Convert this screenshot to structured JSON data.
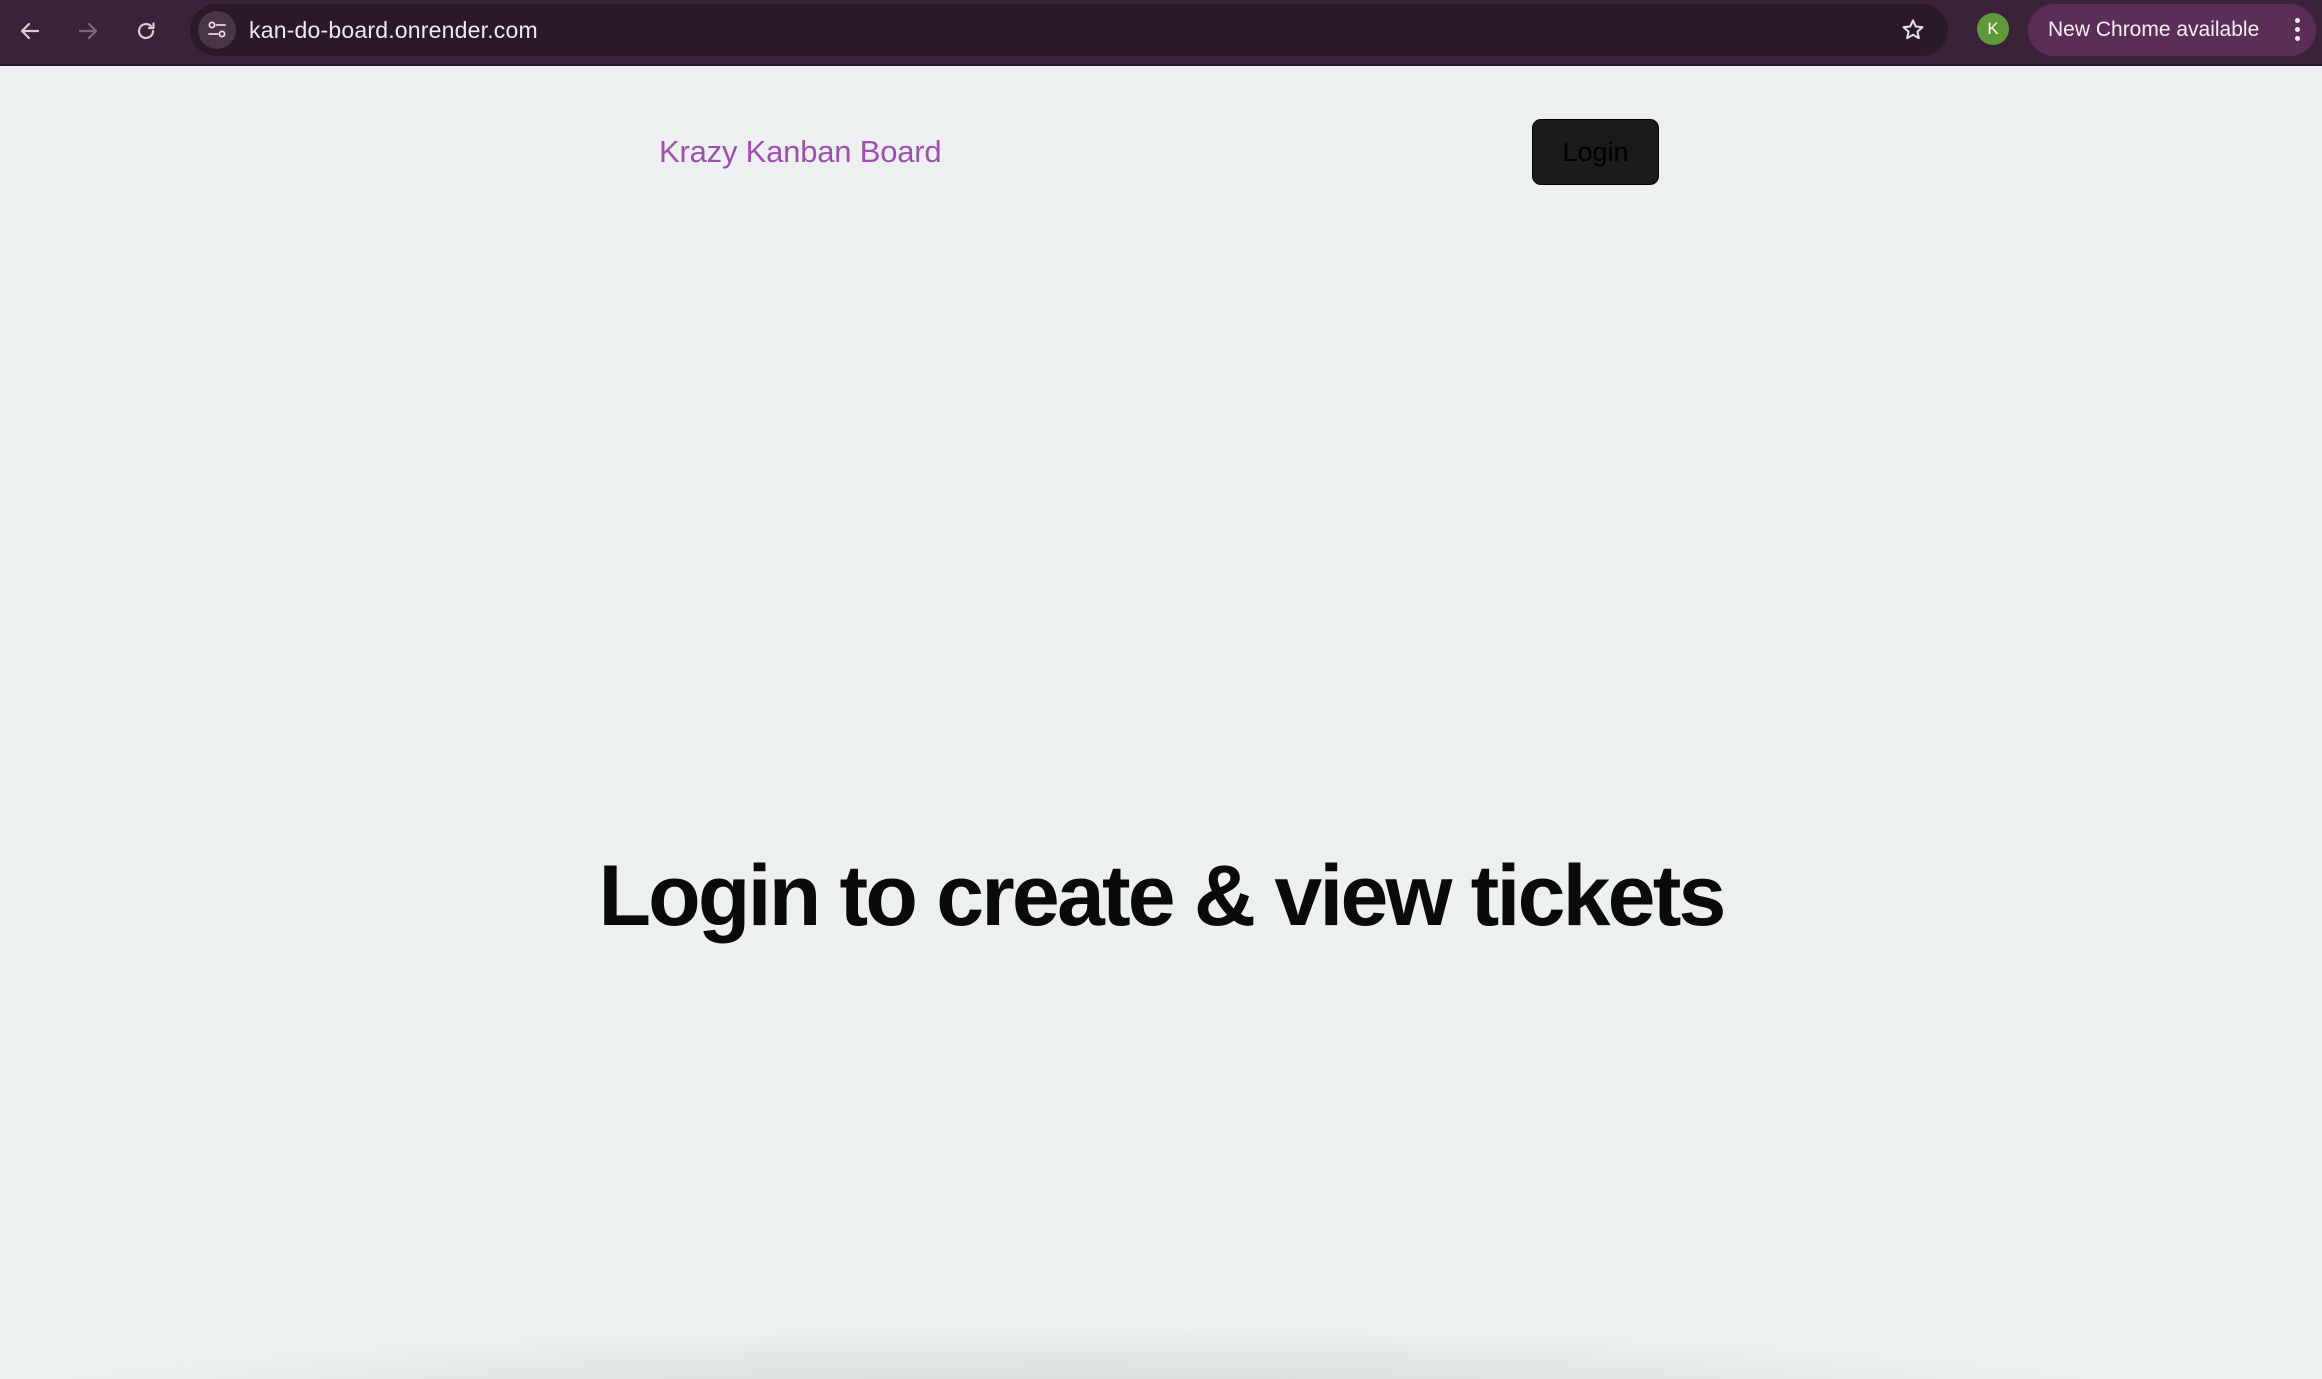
{
  "browser": {
    "url": "kan-do-board.onrender.com",
    "profile_initial": "K",
    "update_label": "New Chrome available",
    "icons": {
      "back": "arrow-left-icon",
      "forward": "arrow-right-icon",
      "reload": "reload-icon",
      "site_info": "tune-icon",
      "bookmark": "star-outline-icon",
      "menu": "kebab-menu-icon"
    },
    "colors": {
      "toolbar": "#3a2238",
      "omnibox": "#2a1a29",
      "update_chip": "#5b2e58",
      "avatar": "#5f9a3a"
    }
  },
  "navbar": {
    "title": "Krazy Kanban Board",
    "login_label": "Login",
    "colors": {
      "title": "#a04fb0",
      "login_background": "#1b1b1b"
    }
  },
  "main": {
    "heading": "Login to create & view tickets",
    "background": "#edf0f1"
  }
}
